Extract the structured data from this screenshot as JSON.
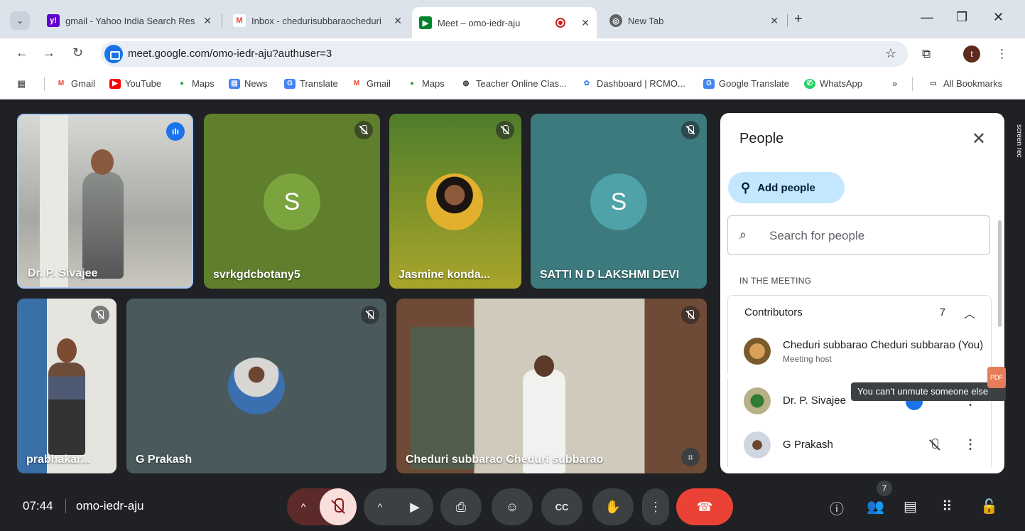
{
  "browser": {
    "tabs": [
      {
        "title": "gmail - Yahoo India Search Res",
        "active": false
      },
      {
        "title": "Inbox - chedurisubbaraocheduri",
        "active": false
      },
      {
        "title": "Meet – omo-iedr-aju",
        "active": true
      },
      {
        "title": "New Tab",
        "active": false
      }
    ],
    "url": "meet.google.com/omo-iedr-aju?authuser=3",
    "profile_initial": "t",
    "bookmarks": [
      "Gmail",
      "YouTube",
      "Maps",
      "News",
      "Translate",
      "Gmail",
      "Maps",
      "Teacher Online Clas...",
      "Dashboard | RCMO...",
      "Google Translate",
      "WhatsApp"
    ],
    "overflow_label": "»",
    "all_bookmarks": "All Bookmarks"
  },
  "meeting": {
    "tiles": [
      {
        "name": "Dr. P. Sivajee",
        "type": "video",
        "speaking": true
      },
      {
        "name": "svrkgdcbotany5",
        "type": "initial",
        "initial": "S",
        "muted": true
      },
      {
        "name": "Jasmine konda...",
        "type": "photo",
        "muted": true
      },
      {
        "name": "SATTI N D LAKSHMI DEVI",
        "type": "initial",
        "initial": "S",
        "muted": true
      },
      {
        "name": "prabhakar...",
        "type": "video",
        "muted": true
      },
      {
        "name": "G Prakash",
        "type": "photo",
        "muted": true
      },
      {
        "name": "Cheduri subbarao Cheduri subbarao",
        "type": "video",
        "muted": true
      }
    ],
    "colors": {
      "tile_green": "#5f7f2c",
      "tile_teal": "#3c7a7e",
      "tile_slate": "#4a5a5c",
      "accent_blue": "#1a73e8",
      "leave_red": "#ea4335"
    }
  },
  "people_panel": {
    "title": "People",
    "add_label": "Add people",
    "search_placeholder": "Search for people",
    "section_label": "IN THE MEETING",
    "group_label": "Contributors",
    "group_count": "7",
    "participants": [
      {
        "name": "Cheduri subbarao Cheduri subbarao (You)",
        "role": "Meeting host"
      },
      {
        "name": "Dr. P. Sivajee",
        "role": ""
      },
      {
        "name": "G Prakash",
        "role": ""
      }
    ],
    "tooltip": "You can't unmute someone else",
    "overlay_label": "screen rec"
  },
  "bottom_bar": {
    "time": "07:44",
    "meeting_code": "omo-iedr-aju",
    "people_count": "7"
  }
}
